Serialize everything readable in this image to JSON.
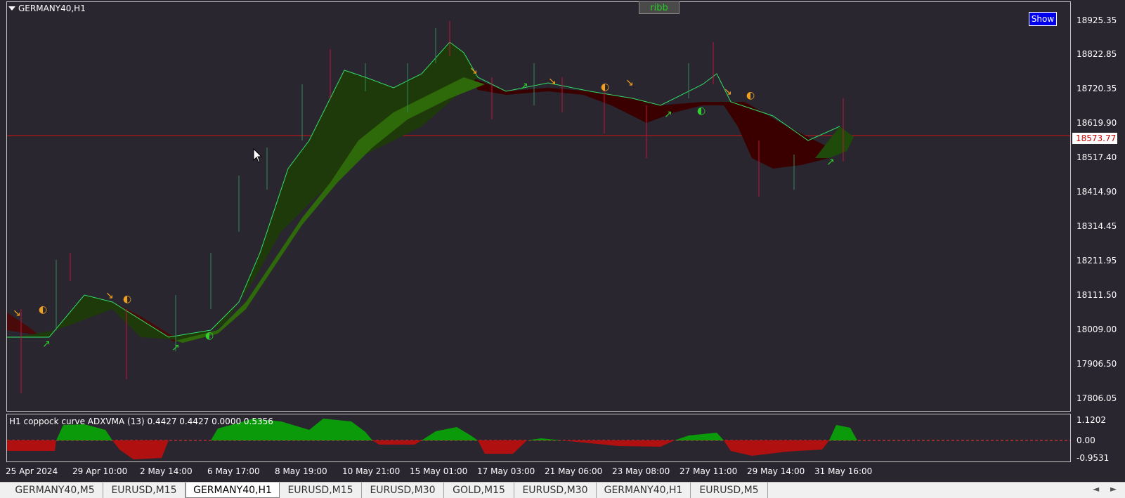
{
  "chart": {
    "symbol_label": "GERMANY40,H1",
    "ribbon_button": "ribb",
    "show_button": "Show",
    "current_price": "18573.77",
    "price_axis": [
      "18925.35",
      "18822.85",
      "18720.35",
      "18619.90",
      "18517.40",
      "18414.90",
      "18314.45",
      "18211.95",
      "18111.50",
      "18009.00",
      "17906.50",
      "17806.05"
    ],
    "indicator_title": "H1 coppock curve ADXVMA (13) 0.4427 0.4427 0.0000 0.5356",
    "indicator_axis": [
      "1.1202",
      "0.00",
      "-0.9531"
    ],
    "time_axis": [
      "25 Apr 2024",
      "29 Apr 10:00",
      "2 May 14:00",
      "6 May 17:00",
      "8 May 19:00",
      "10 May 21:00",
      "15 May 01:00",
      "17 May 03:00",
      "21 May 06:00",
      "23 May 08:00",
      "27 May 11:00",
      "29 May 14:00",
      "31 May 16:00"
    ],
    "colors": {
      "background": "#2a2630",
      "bull_candle": "#2e8b57",
      "bear_candle": "#c0143c",
      "ribbon_green": "#2e5e0e",
      "ribbon_red": "#6e0000",
      "price_line": "#d01010",
      "signal_arrow": "#f0a020"
    }
  },
  "tabs": [
    {
      "label": "GERMANY40,M5",
      "active": false
    },
    {
      "label": "EURUSD,M15",
      "active": false
    },
    {
      "label": "GERMANY40,H1",
      "active": true
    },
    {
      "label": "EURUSD,M15",
      "active": false
    },
    {
      "label": "EURUSD,M30",
      "active": false
    },
    {
      "label": "GOLD,M15",
      "active": false
    },
    {
      "label": "EURUSD,M30",
      "active": false
    },
    {
      "label": "GERMANY40,H1",
      "active": false
    },
    {
      "label": "EURUSD,M5",
      "active": false
    }
  ],
  "nav": {
    "left": "◄",
    "right": "►"
  }
}
